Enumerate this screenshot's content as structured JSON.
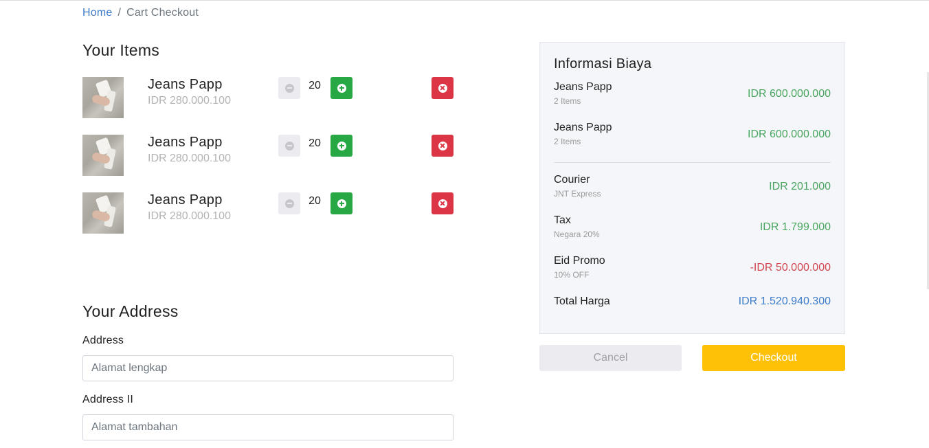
{
  "breadcrumb": {
    "home": "Home",
    "separator": "/",
    "current": "Cart Checkout"
  },
  "items_section": {
    "title": "Your Items"
  },
  "items": [
    {
      "name": "Jeans Papp",
      "price": "IDR 280.000.100",
      "quantity": "20"
    },
    {
      "name": "Jeans Papp",
      "price": "IDR 280.000.100",
      "quantity": "20"
    },
    {
      "name": "Jeans Papp",
      "price": "IDR 280.000.100",
      "quantity": "20"
    }
  ],
  "address_section": {
    "title": "Your Address",
    "address_label": "Address",
    "address_placeholder": "Alamat lengkap",
    "address2_label": "Address II",
    "address2_placeholder": "Alamat tambahan"
  },
  "summary": {
    "title": "Informasi Biaya",
    "lines": [
      {
        "name": "Jeans Papp",
        "sub": "2 Items",
        "value": "IDR 600.000.000"
      },
      {
        "name": "Jeans Papp",
        "sub": "2 Items",
        "value": "IDR 600.000.000"
      }
    ],
    "courier": {
      "name": "Courier",
      "sub": "JNT Express",
      "value": "IDR 201.000"
    },
    "tax": {
      "name": "Tax",
      "sub": "Negara 20%",
      "value": "IDR 1.799.000"
    },
    "promo": {
      "name": "Eid Promo",
      "sub": "10% OFF",
      "value": "-IDR 50.000.000"
    },
    "total": {
      "name": "Total Harga",
      "value": "IDR 1.520.940.300"
    }
  },
  "actions": {
    "cancel": "Cancel",
    "checkout": "Checkout"
  },
  "icons": {
    "decrease": "minus-circle-icon",
    "increase": "plus-circle-icon",
    "remove": "times-circle-icon"
  },
  "colors": {
    "link": "#3d7cc9",
    "increase_button": "#28a745",
    "remove_button": "#dc3545",
    "checkout_button": "#ffc107",
    "positive_value": "#47a55e",
    "negative_value": "#d2464f",
    "total_value": "#3d7cc9"
  }
}
